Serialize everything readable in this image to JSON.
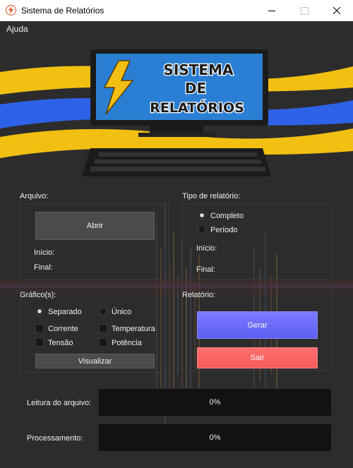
{
  "window": {
    "title": "Sistema de Relatórios"
  },
  "menu": {
    "items": [
      "Ajuda"
    ]
  },
  "banner": {
    "lines": [
      "SISTEMA",
      "DE",
      "RELATÓRIOS"
    ]
  },
  "arquivo": {
    "label": "Arquivo:",
    "open_button": "Abrir",
    "inicio_label": "Início:",
    "final_label": "Final:"
  },
  "tipo_relatorio": {
    "label": "Tipo de relatório:",
    "options": [
      {
        "label": "Completo",
        "checked": true
      },
      {
        "label": "Período",
        "checked": false
      }
    ],
    "inicio_label": "Início:",
    "final_label": "Final:"
  },
  "graficos": {
    "label": "Gráfico(s):",
    "mode_options": [
      {
        "label": "Separado",
        "checked": true
      },
      {
        "label": "Único",
        "checked": false
      }
    ],
    "series": [
      "Corrente",
      "Temperatura",
      "Tensão",
      "Potência"
    ],
    "visualize_button": "Visualizar"
  },
  "relatorio": {
    "label": "Relatório:",
    "generate_button": "Gerar",
    "exit_button": "Sair"
  },
  "progress": {
    "leitura_label": "Leitura do arquivo:",
    "leitura_value": "0%",
    "leitura_fraction": 0,
    "processamento_label": "Processamento:",
    "processamento_value": "0%",
    "processamento_fraction": 0
  },
  "colors": {
    "accent_generate": "#6b6bfb",
    "accent_exit": "#f96464",
    "banner_yellow": "#f2c012",
    "banner_blue": "#2e62e8",
    "app_icon": "#d9531e"
  }
}
